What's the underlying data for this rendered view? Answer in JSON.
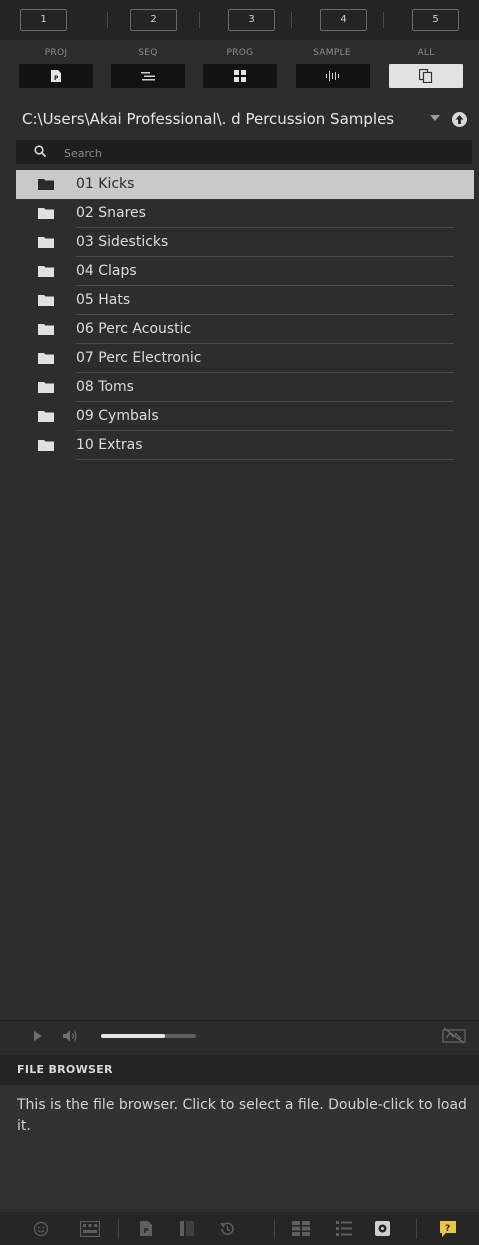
{
  "tabs": [
    "1",
    "2",
    "3",
    "4",
    "5"
  ],
  "modes": [
    {
      "label": "PROJ",
      "icon": "project-icon"
    },
    {
      "label": "SEQ",
      "icon": "sequence-icon"
    },
    {
      "label": "PROG",
      "icon": "program-icon"
    },
    {
      "label": "SAMPLE",
      "icon": "sample-icon"
    },
    {
      "label": "ALL",
      "icon": "all-icon",
      "active": true
    }
  ],
  "path": {
    "text": "C:\\Users\\Akai Professional\\. d Percussion Samples"
  },
  "search": {
    "placeholder": "Search",
    "value": ""
  },
  "files": [
    {
      "name": "01 Kicks",
      "selected": true
    },
    {
      "name": "02 Snares"
    },
    {
      "name": "03 Sidesticks"
    },
    {
      "name": "04 Claps"
    },
    {
      "name": "05 Hats"
    },
    {
      "name": "06 Perc Acoustic"
    },
    {
      "name": "07 Perc Electronic"
    },
    {
      "name": "08 Toms"
    },
    {
      "name": "09 Cymbals"
    },
    {
      "name": "10 Extras"
    }
  ],
  "preview": {
    "volume_fraction": 0.67
  },
  "info": {
    "title": "FILE BROWSER",
    "text": "This is the file browser. Click to select a file. Double-click to load it."
  },
  "colors": {
    "background": "#2d2d2d",
    "selected_row": "#c9c9c9",
    "active_mode": "#e2e2e2",
    "help_accent": "#e8c547"
  }
}
